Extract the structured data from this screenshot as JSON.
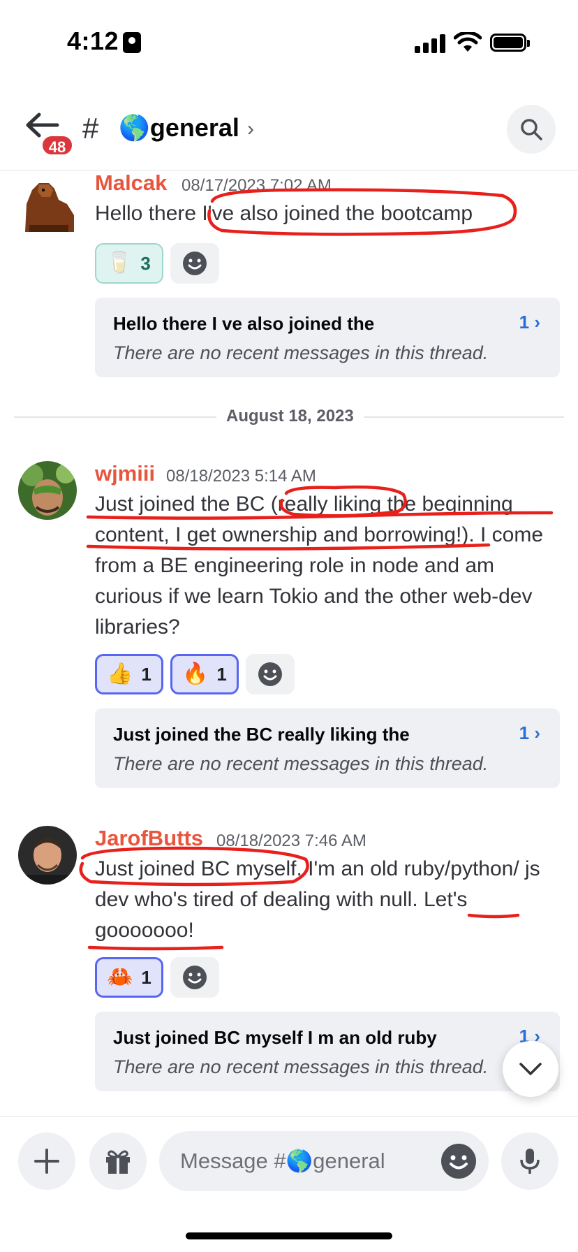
{
  "status_bar": {
    "time": "4:12"
  },
  "header": {
    "unread_badge": "48",
    "hash": "#",
    "channel": "🌎general",
    "chevron": "›"
  },
  "messages": [
    {
      "author": "Malcak",
      "timestamp": "08/17/2023 7:02 AM",
      "text": "Hello there I've also joined the bootcamp",
      "reactions": [
        {
          "emoji": "🥛",
          "count": "3"
        }
      ],
      "thread": {
        "title": "Hello there I ve also joined the",
        "count": "1 ›",
        "subtitle": "There are no recent messages in this thread."
      }
    },
    {
      "author": "wjmiii",
      "timestamp": "08/18/2023 5:14 AM",
      "text": "Just joined the BC (really liking the beginning content, I get ownership and borrowing!). I come from a BE engineering role in node and am curious if we learn Tokio and the other web-dev libraries?",
      "reactions": [
        {
          "emoji": "👍",
          "count": "1"
        },
        {
          "emoji": "🔥",
          "count": "1"
        }
      ],
      "thread": {
        "title": "Just joined the BC really liking the",
        "count": "1 ›",
        "subtitle": "There are no recent messages in this thread."
      }
    },
    {
      "author": "JarofButts",
      "timestamp": "08/18/2023 7:46 AM",
      "text": "Just joined BC myself. I'm an old ruby/python/ js dev who's tired of dealing with null. Let's gooooooo!",
      "reactions": [
        {
          "emoji": "🦀",
          "count": "1"
        }
      ],
      "thread": {
        "title": "Just joined BC myself I m an old ruby",
        "count": "1 ›",
        "subtitle": "There are no recent messages in this thread."
      }
    }
  ],
  "date_divider": "August 18, 2023",
  "composer": {
    "placeholder": "Message #🌎general"
  },
  "colors": {
    "accent": "#5865f2",
    "author": "#e8553e",
    "badge": "#da373c",
    "annotation": "#e8201c"
  }
}
